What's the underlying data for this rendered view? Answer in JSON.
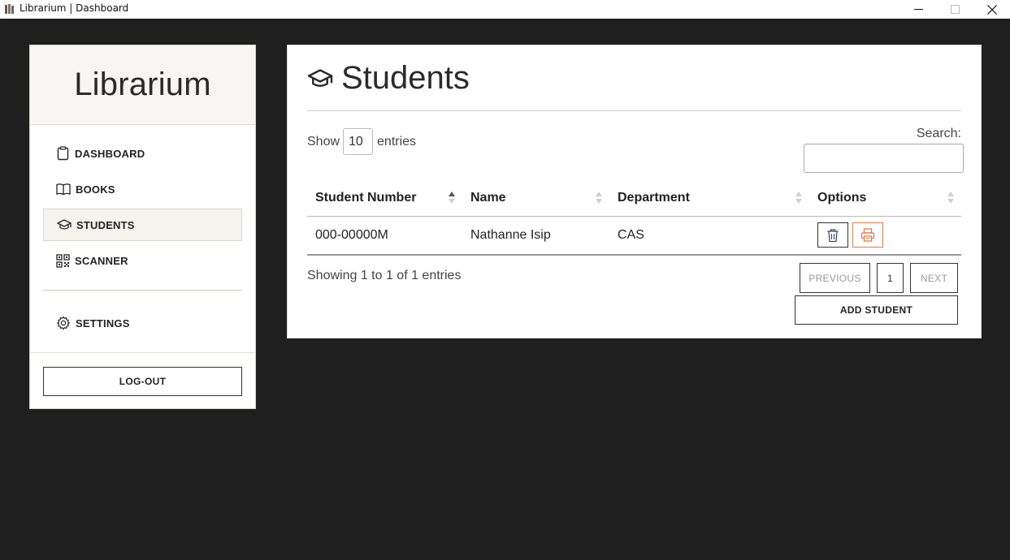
{
  "window": {
    "title": "Librarium | Dashboard",
    "controls": [
      "minimize",
      "maximize",
      "close"
    ]
  },
  "sidebar": {
    "brand": "Librarium",
    "items": [
      {
        "label": "DASHBOARD",
        "icon": "clipboard-icon",
        "active": false
      },
      {
        "label": "BOOKS",
        "icon": "book-icon",
        "active": false
      },
      {
        "label": "STUDENTS",
        "icon": "graduation-cap-icon",
        "active": true
      },
      {
        "label": "SCANNER",
        "icon": "qr-code-icon",
        "active": false
      },
      {
        "label": "SETTINGS",
        "icon": "gear-icon",
        "active": false
      }
    ],
    "logout_label": "LOG-OUT"
  },
  "main": {
    "title": "Students",
    "title_icon": "graduation-cap-icon",
    "show_label": "Show",
    "entries_value": "10",
    "entries_label": "entries",
    "search_label": "Search:",
    "search_value": "",
    "table": {
      "columns": [
        "Student Number",
        "Name",
        "Department",
        "Options"
      ],
      "sorted_column": "Student Number",
      "rows": [
        {
          "student_number": "000-00000M",
          "name": "Nathanne Isip",
          "department": "CAS",
          "options": [
            "trash-icon",
            "printer-icon"
          ]
        }
      ]
    },
    "info_text": "Showing 1 to 1 of 1 entries",
    "pagination": {
      "previous": "PREVIOUS",
      "current": "1",
      "next": "NEXT"
    },
    "add_label": "ADD STUDENT"
  },
  "colors": {
    "background": "#1f1f1f",
    "panel": "#ffffff",
    "sidebar_header": "#f8f6f2",
    "print_accent": "#e07b49"
  }
}
